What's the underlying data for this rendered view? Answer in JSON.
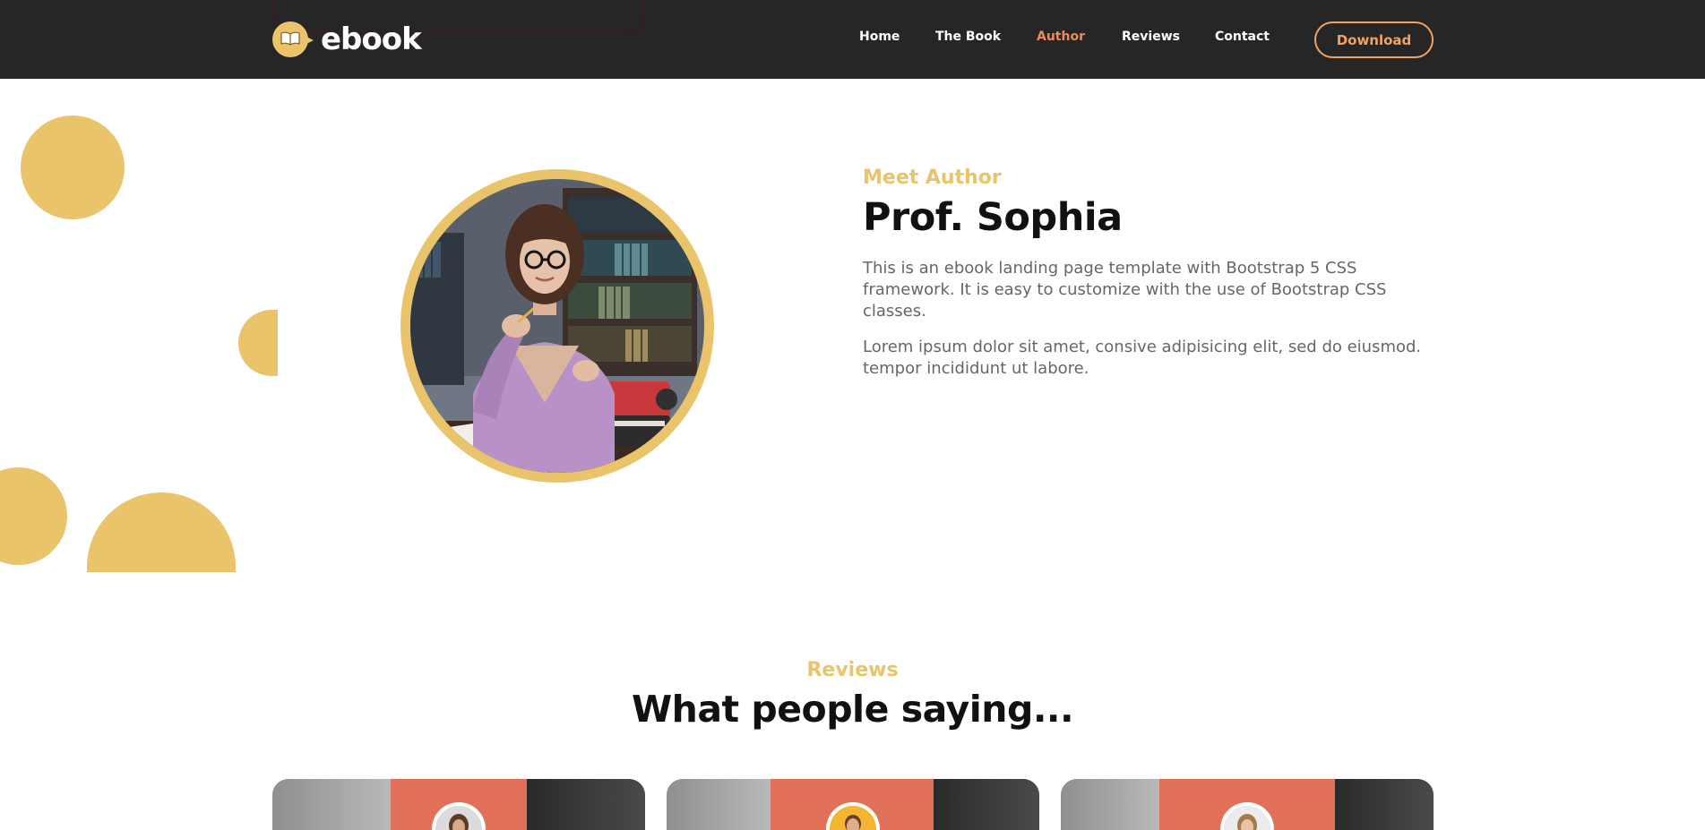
{
  "brand": {
    "name": "ebook",
    "icon": "open-book-icon"
  },
  "nav": {
    "links": [
      {
        "label": "Home",
        "active": false
      },
      {
        "label": "The Book",
        "active": false
      },
      {
        "label": "Author",
        "active": true
      },
      {
        "label": "Reviews",
        "active": false
      },
      {
        "label": "Contact",
        "active": false
      }
    ],
    "download_label": "Download"
  },
  "author": {
    "kicker": "Meet Author",
    "name": "Prof. Sophia",
    "paragraphs": [
      "This is an ebook landing page template with Bootstrap 5 CSS framework. It is easy to customize with the use of Bootstrap CSS classes.",
      "Lorem ipsum dolor sit amet, consive adipisicing elit, sed do eiusmod. tempor incididunt ut labore."
    ]
  },
  "reviews": {
    "kicker": "Reviews",
    "title": "What people saying..."
  },
  "colors": {
    "navbar_bg": "#262626",
    "accent_yellow": "#e9c46a",
    "accent_orange": "#f4a261",
    "active_link": "#f08a5d",
    "card_band": "#e07158"
  }
}
